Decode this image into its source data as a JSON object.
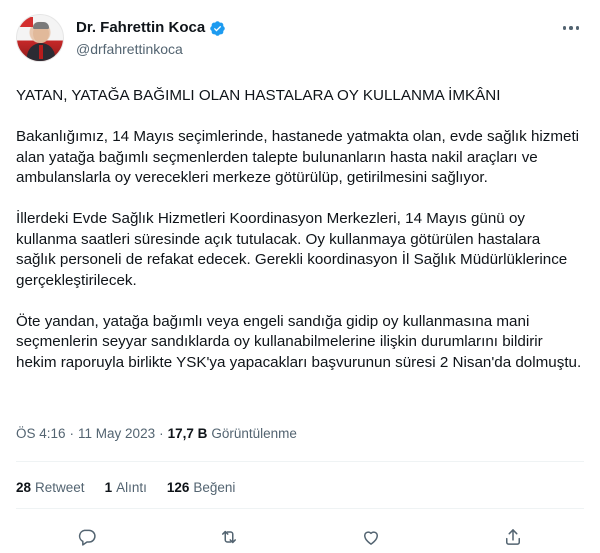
{
  "author": {
    "display_name": "Dr. Fahrettin Koca",
    "handle": "@drfahrettinkoca"
  },
  "tweet": {
    "paragraphs": [
      "YATAN, YATAĞA BAĞIMLI OLAN HASTALARA OY KULLANMA İMKÂNI",
      "Bakanlığımız, 14 Mayıs seçimlerinde, hastanede yatmakta olan, evde sağlık hizmeti alan yatağa bağımlı seçmenlerden talepte bulunanların hasta nakil araçları ve ambulanslarla oy verecekleri merkeze götürülüp, getirilmesini sağlıyor.",
      "İllerdeki Evde Sağlık Hizmetleri Koordinasyon Merkezleri, 14 Mayıs günü oy kullanma saatleri süresinde açık tutulacak. Oy kullanmaya götürülen hastalara sağlık personeli de refakat edecek. Gerekli koordinasyon İl Sağlık Müdürlüklerince gerçekleştirilecek.",
      "Öte yandan, yatağa bağımlı veya engeli sandığa gidip oy kullanmasına mani seçmenlerin seyyar sandıklarda oy kullanabilmelerine ilişkin durumlarını bildirir hekim raporuyla birlikte YSK'ya yapacakları başvurunun süresi 2 Nisan'da dolmuştu."
    ]
  },
  "meta": {
    "time": "ÖS 4:16",
    "separator": "·",
    "date": "11 May 2023",
    "views_count": "17,7 B",
    "views_label": "Görüntülenme"
  },
  "stats": {
    "retweets": {
      "count": "28",
      "label": "Retweet"
    },
    "quotes": {
      "count": "1",
      "label": "Alıntı"
    },
    "likes": {
      "count": "126",
      "label": "Beğeni"
    }
  },
  "actions": {
    "icons": [
      "reply-icon",
      "retweet-icon",
      "like-icon",
      "share-icon"
    ]
  },
  "colors": {
    "text": "#0f1419",
    "secondary": "#536471",
    "verified": "#1d9bf0",
    "divider": "#eff3f4"
  }
}
